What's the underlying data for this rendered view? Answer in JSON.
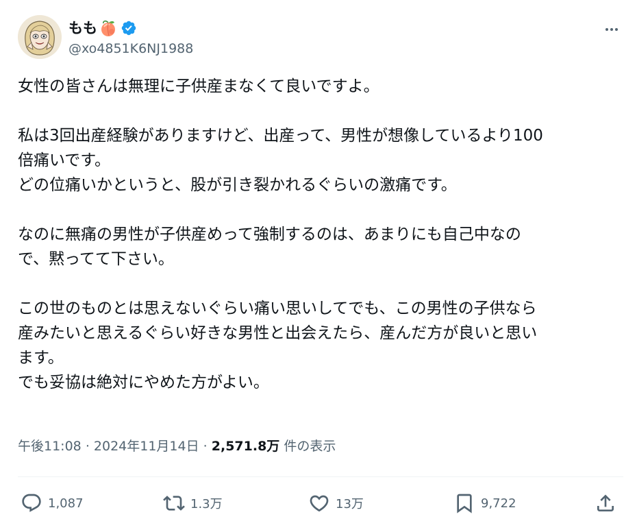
{
  "author": {
    "display_name": "もも",
    "emoji_icon": "peach-emoji-icon",
    "verified_icon": "verified-badge-icon",
    "handle": "@xo4851K6NJ1988"
  },
  "more_icon": "more-dots-icon",
  "body": {
    "paragraphs": [
      [
        "女性の皆さんは無理に子供産まなくて良いですよ。"
      ],
      [
        "私は3回出産経験がありますけど、出産って、男性が想像しているより100",
        "倍痛いです。",
        "どの位痛いかというと、股が引き裂かれるぐらいの激痛です。"
      ],
      [
        "なのに無痛の男性が子供産めって強制するのは、あまりにも自己中なの",
        "で、黙ってて下さい。"
      ],
      [
        "この世のものとは思えないぐらい痛い思いしてでも、この男性の子供なら",
        "産みたいと思えるぐらい好きな男性と出会えたら、産んだ方が良いと思い",
        "ます。",
        "でも妥協は絶対にやめた方がよい。"
      ]
    ]
  },
  "meta": {
    "time": "午後11:08",
    "separator": "·",
    "date": "2024年11月14日",
    "views_count": "2,571.8万",
    "views_label": "件の表示"
  },
  "actions": {
    "reply": {
      "icon": "reply-bubble-icon",
      "count": "1,087"
    },
    "repost": {
      "icon": "repost-arrows-icon",
      "count": "1.3万"
    },
    "like": {
      "icon": "heart-icon",
      "count": "13万"
    },
    "bookmark": {
      "icon": "bookmark-icon",
      "count": "9,722"
    },
    "share": {
      "icon": "share-upload-icon"
    }
  },
  "colors": {
    "text_primary": "#0f1419",
    "text_secondary": "#536471",
    "verified_blue": "#1d9bf0",
    "divider": "#eff3f4"
  }
}
